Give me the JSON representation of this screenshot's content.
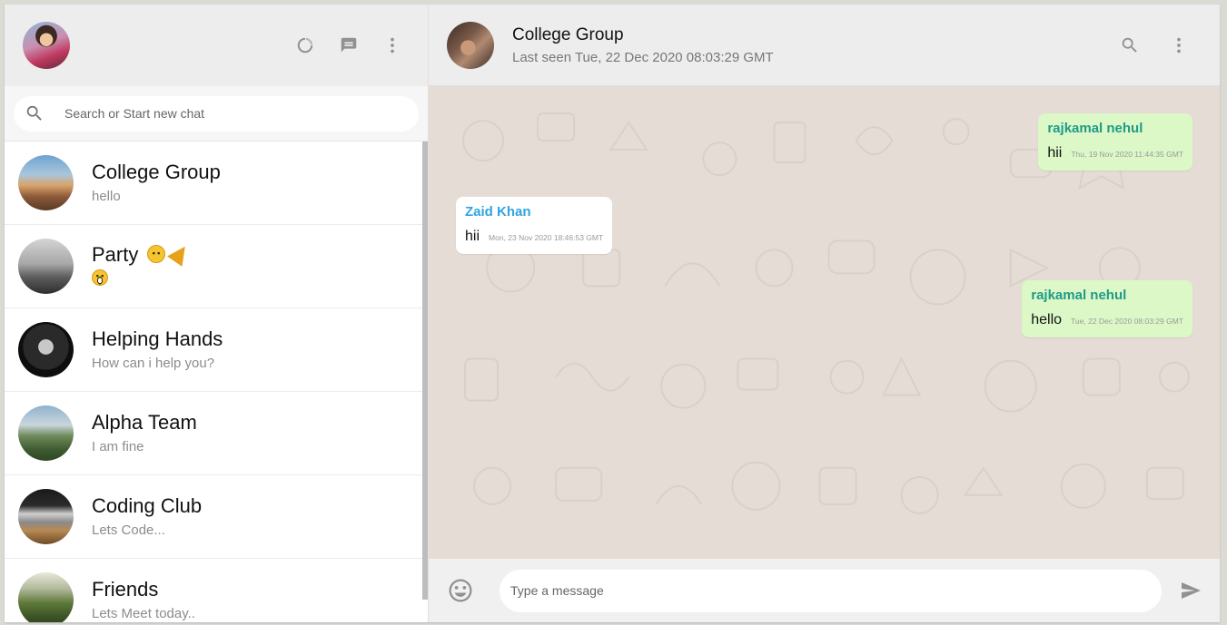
{
  "sidebar": {
    "header": {
      "icons": [
        "status-icon",
        "new-chat-icon",
        "menu-dots-icon"
      ]
    },
    "search": {
      "placeholder": "Search or Start new chat"
    },
    "chats": [
      {
        "name": "College Group",
        "last": "hello"
      },
      {
        "name": "Party",
        "last": ""
      },
      {
        "name": "Helping Hands",
        "last": "How can i help you?"
      },
      {
        "name": "Alpha Team",
        "last": "I am fine"
      },
      {
        "name": "Coding Club",
        "last": "Lets Code..."
      },
      {
        "name": "Friends",
        "last": "Lets Meet today.."
      }
    ]
  },
  "main": {
    "header": {
      "title": "College Group",
      "subtitle": "Last seen Tue, 22 Dec 2020 08:03:29 GMT"
    },
    "messages": [
      {
        "sender": "rajkamal nehul",
        "text": "hii",
        "time": "Thu, 19 Nov 2020 11:44:35 GMT",
        "mine": true
      },
      {
        "sender": "Zaid Khan",
        "text": "hii",
        "time": "Mon, 23 Nov 2020 18:46:53 GMT",
        "mine": false
      },
      {
        "sender": "rajkamal nehul",
        "text": "hello",
        "time": "Tue, 22 Dec 2020 08:03:29 GMT",
        "mine": true
      }
    ],
    "footer": {
      "placeholder": "Type a message"
    }
  },
  "colors": {
    "sent_bubble": "#dcf8c6",
    "received_bubble": "#ffffff",
    "sender_mine": "#1f9a8a",
    "sender_other": "#2fa4e0",
    "chat_bg": "#e5ddd5"
  }
}
